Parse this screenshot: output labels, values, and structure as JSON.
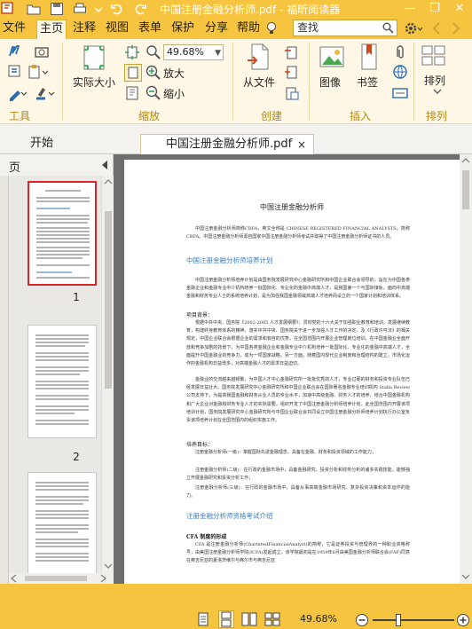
{
  "window": {
    "title": "中国注册金融分析师.pdf - 福昕阅读器",
    "min_symbol": "—",
    "restore_symbol": "❐",
    "close_symbol": "✕"
  },
  "menu": {
    "file": "文件",
    "home": "主页",
    "comment": "注释",
    "view": "视图",
    "form": "表单",
    "protect": "保护",
    "share": "分享",
    "help": "帮助"
  },
  "search": {
    "placeholder": "查找"
  },
  "ribbon": {
    "groups": {
      "tools": "工具",
      "zoom": "缩放",
      "create": "创建",
      "insert": "插入",
      "arrange": "排列"
    },
    "zoom_value": "49.68%",
    "actual_size": "实际大小",
    "zoom_in": "放大",
    "zoom_out": "缩小",
    "from_file": "从文件",
    "image": "图像",
    "bookmark": "书签",
    "arrange": "排列"
  },
  "tabs": {
    "start": "开始",
    "doc": "中国注册金融分析师.pdf",
    "close": "×"
  },
  "panel": {
    "title": "页",
    "page_numbers": [
      "1",
      "2"
    ]
  },
  "document": {
    "title": "中国注册金融分析师",
    "intro": "中国注册金融分析师简称CRFA，英文全称是 CHINESE REGISTERED FINANCIAL ANALYSTS，简称 CRFA。中国注册金融分析师源自国家中国注册金融分析师考试并取得了中国注册金融分析师证书的人员。",
    "h1": "中国注册金融分析师培养计划",
    "p1": "中国注册金融分析师培养计划是由国务院发展研究中心金融研究所和中国企业联合会领导的，旨在为中国各类金融企业和金融专业中介机构培养一批国际化、专业化的金融中高端人才，是我国第一个与国际接轨、面向中高端金融和财务专业人士的系统培养计划，是为加强我国金融领域高端人才培养而设立的一个国家计划和培训体系。",
    "b1": "项目背景：",
    "p2": "根据中共中央、国务院《2002-2005 人才发展纲要》，贯彻党的十六大关于加强职业教育和培训，发展继续教育，构建终身教育体系的精神，落实中共中央、国务院关于进一步加强人才工作的决定，及《行政许可法》的相关规定，中国企业联合会根据企业的需求和有自的优势，在全国范围内开展企业管理岗位培训。在中国金融业全面开放和竞争加剧的背景下，为中国各类金融企业和金融专业中介机构培养一批国际化、专业化的金融中高端人才，全面提升中国金融业的竞争力，成为一项国家战略。另一方面，随着国内现代企业制度和治理结构的建立，市场化运作的金融机构日益增多，对高端金融人才的需求日益迫切。",
    "p3": "金融业的交流越来越频繁，为中国人才中心金融研究所一批批优秀的人才，专业过硬的财务和投资专业队伍已经发展日益壮大。国务院发展研究中心金融研究所和中国企业联合会在国际著名金融专业培训机构 Stalla Review 公司支持下，为提高我国金融和财务从业人员的专业水平，加速中高级金融、财务人才的培养，结合中国金融机构和广大企业对金融和财务专业人才的实际需要，组织开发了中国注册金融分析师培养计划，此全国范围内开展该项培训计划，国务院发展研究中心金融研究所与中国企业联合会共同设立中国注册金融分析师培养计划执行办公室负责该项培养计划在全国范围内的组织实施工作。",
    "b2": "培养目标：",
    "p4": "注册金融分析师(一级)：掌握国际先进金融理念，具备在金融、财务和投资领域的工作能力；",
    "p5": "注册金融分析师(二级)：在行政的金融市场中，具备金融研究、投资分析和财务分析的诸多实践技能，能够独立开展金融研究和投资分析工作；",
    "p6": "注册金融分析师(三级)：在行政的金融市场中，具备从事高端金融市场研究、复杂投资决策和资本运作的能力。",
    "h2": "注册金融分析师资格考试介绍",
    "b3": "CFA 制度的形成",
    "p7": "CFA 是注册金融分析师(CharteredFinancialAnalyst)的简称，它是证券投资与管理界的一种职业资格称号，由美国注册金融分析师学院(ICFA)发起成立。该学院最初是在1959年6月由美国金融分析师联合会(FAF)同意在弗吉尼亚的夏洛茨维尔与弗尔市与弗吉尼亚"
  },
  "status": {
    "zoom": "49.68%"
  }
}
